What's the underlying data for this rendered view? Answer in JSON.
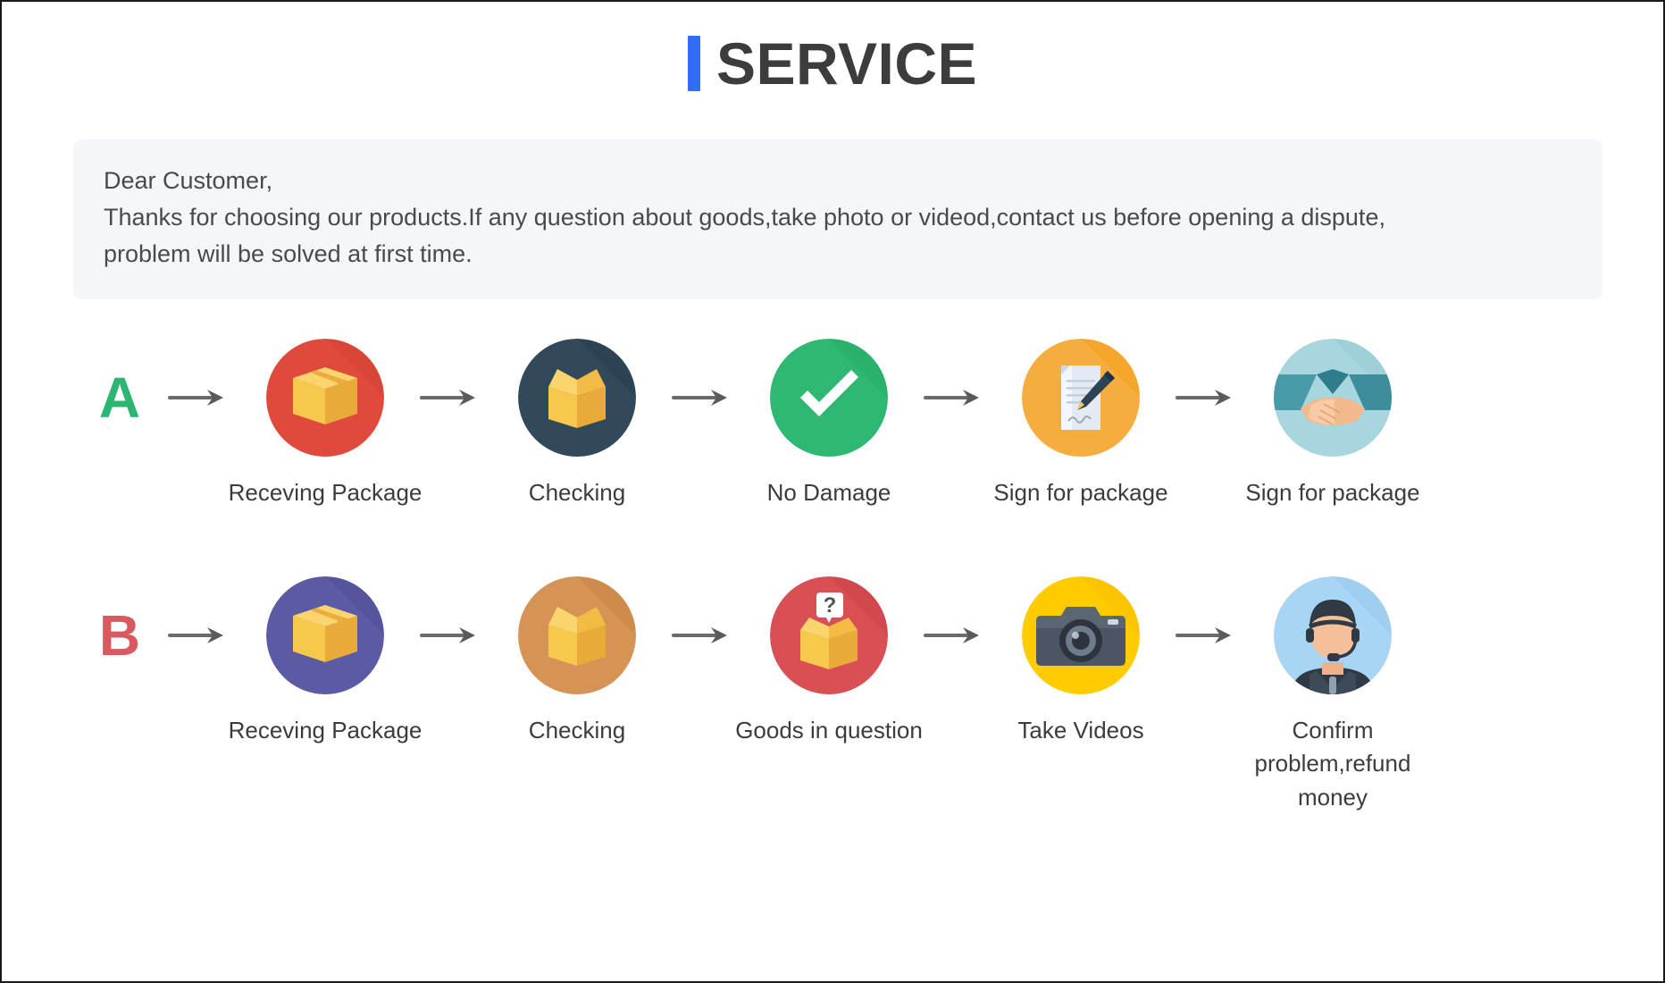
{
  "title": {
    "text": "SERVICE",
    "accent_bar_color": "#2f6df6",
    "text_color": "#3c3c3c"
  },
  "notice": {
    "background": "#f4f6fa",
    "lines": [
      "Dear Customer,",
      "Thanks for choosing our products.If any question about goods,take photo or videod,contact us before opening a dispute,",
      "problem will be solved at first time."
    ]
  },
  "flows": [
    {
      "badge": "A",
      "badge_color": "#2bb673",
      "steps": [
        {
          "label": "Receving Package",
          "icon": "package-box-icon",
          "circle_color": "#e04a3c",
          "shadow_color": "#c8402f"
        },
        {
          "label": "Checking",
          "icon": "open-box-icon",
          "circle_color": "#31495a",
          "shadow_color": "#25394a"
        },
        {
          "label": "No Damage",
          "icon": "check-mark-icon",
          "circle_color": "#2eb872",
          "shadow_color": "#22a261"
        },
        {
          "label": "Sign for package",
          "icon": "document-pen-icon",
          "circle_color": "#f6ad3f",
          "shadow_color": "#f59b0b"
        },
        {
          "label": "Sign for package",
          "icon": "handshake-icon",
          "circle_color": "#a8d6de",
          "shadow_color": "#8fc6d1"
        }
      ]
    },
    {
      "badge": "B",
      "badge_color": "#d9595e",
      "steps": [
        {
          "label": "Receving Package",
          "icon": "package-box-icon",
          "circle_color": "#5b5ba5",
          "shadow_color": "#4b4b8f"
        },
        {
          "label": "Checking",
          "icon": "open-box-icon",
          "circle_color": "#d59355",
          "shadow_color": "#c07f43"
        },
        {
          "label": "Goods in question",
          "icon": "question-box-icon",
          "circle_color": "#d94f54",
          "shadow_color": "#c23f45"
        },
        {
          "label": "Take Videos",
          "icon": "camera-icon",
          "circle_color": "#ffcc00",
          "shadow_color": "#f2b700"
        },
        {
          "label": "Confirm problem,refund money",
          "icon": "support-agent-icon",
          "circle_color": "#a8d5f5",
          "shadow_color": "#8fc4ec"
        }
      ]
    }
  ],
  "arrow": {
    "name": "arrow-right-icon",
    "color": "#5a5a5a"
  }
}
